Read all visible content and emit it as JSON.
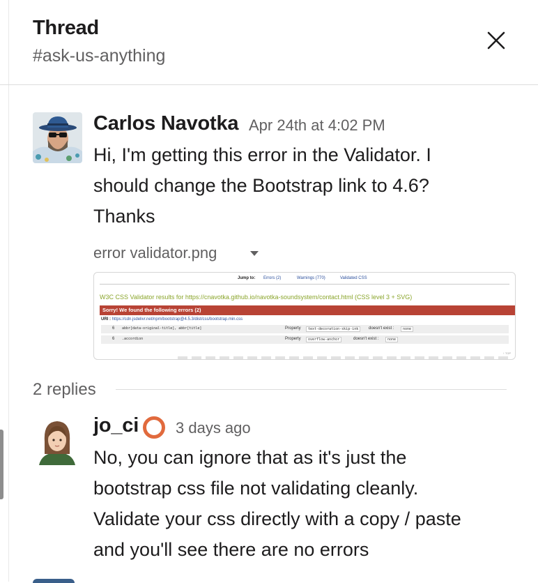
{
  "header": {
    "title": "Thread",
    "channel": "#ask-us-anything"
  },
  "parent_message": {
    "author": "Carlos Navotka",
    "timestamp": "Apr 24th at 4:02 PM",
    "lines": [
      "Hi, I'm getting this error in the Validator. I",
      "should change the Bootstrap link to 4.6?",
      "Thanks"
    ],
    "attachment": {
      "filename": "error validator.png",
      "preview": {
        "nav": [
          "Jump to:",
          "Errors (2)",
          "Warnings (770)",
          "Validated CSS"
        ],
        "heading": "W3C CSS Validator results for https://cnavotka.github.io/navotka-soundsystem/contact.html (CSS level 3 + SVG)",
        "error_bar": "Sorry! We found the following errors (2)",
        "uri_label": "URI :",
        "uri": "https://cdn.jsdelivr.net/npm/bootstrap@4.5.3/dist/css/bootstrap.min.css",
        "rows": [
          {
            "line": "6",
            "selector": "abbr[data-original-title], abbr[title]",
            "prop_label": "Property",
            "property": "text-decoration-skip-ink",
            "msg": "doesn't exist :",
            "value": "none"
          },
          {
            "line": "6",
            "selector": ".accordion",
            "prop_label": "Property",
            "property": "overflow-anchor",
            "msg": "doesn't exist :",
            "value": "none"
          }
        ],
        "corner": "↑ TOP"
      }
    }
  },
  "replies": {
    "count_label": "2 replies"
  },
  "reply_message": {
    "author": "jo_ci",
    "timestamp": "3 days ago",
    "lines": [
      "No, you can ignore that as it's just the",
      "bootstrap css file not validating cleanly.",
      "Validate your css directly with a copy / paste",
      "and you'll see there are no errors"
    ]
  },
  "icons": {
    "close": "close-icon",
    "caret": "caret-down-icon",
    "status": "status-ring-icon"
  },
  "colors": {
    "status_ring": "#e16a3d",
    "error_bar": "#b84335",
    "validator_heading": "#8aa52b"
  }
}
